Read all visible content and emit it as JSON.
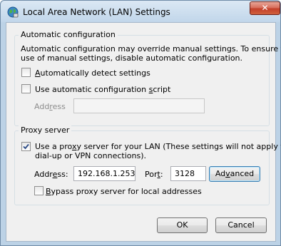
{
  "window": {
    "title": "Local Area Network (LAN) Settings",
    "close_glyph": "✕"
  },
  "automatic": {
    "group_title": "Automatic configuration",
    "description_line1": "Automatic configuration may override manual settings.  To ensure the",
    "description_line2": "use of manual settings, disable automatic configuration.",
    "detect": {
      "label_prefix": "",
      "label_accel": "A",
      "label_rest": "utomatically detect settings",
      "checked": false
    },
    "script": {
      "label_prefix": "Use automatic configuration ",
      "label_accel": "s",
      "label_rest": "cript",
      "checked": false
    },
    "address_label_prefix": "Add",
    "address_label_accel": "r",
    "address_label_rest": "ess",
    "address_value": ""
  },
  "proxy": {
    "group_title": "Proxy server",
    "use_proxy": {
      "line1_prefix": "Use a pro",
      "line1_accel": "x",
      "line1_rest": "y server for your LAN (These settings will not apply to",
      "line2": "dial-up or VPN connections).",
      "checked": true
    },
    "address_label_prefix": "Addr",
    "address_label_accel": "e",
    "address_label_rest": "ss:",
    "address_value": "192.168.1.253",
    "port_label_prefix": "Por",
    "port_label_accel": "t",
    "port_label_rest": ":",
    "port_value": "3128",
    "advanced_prefix": "Ad",
    "advanced_accel": "v",
    "advanced_rest": "anced",
    "bypass": {
      "label_prefix": "",
      "label_accel": "B",
      "label_rest": "ypass proxy server for local addresses",
      "checked": false
    }
  },
  "buttons": {
    "ok": "OK",
    "cancel": "Cancel"
  },
  "icons": {
    "app_icon": "network-globe-icon",
    "close": "close-icon",
    "check": "checkmark-icon"
  }
}
